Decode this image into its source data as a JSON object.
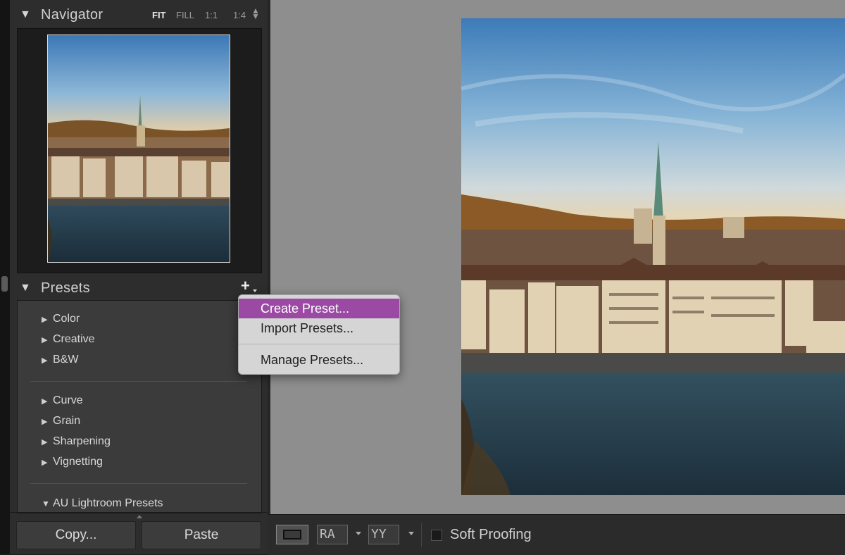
{
  "navigator": {
    "title": "Navigator",
    "zoom_options": [
      "FIT",
      "FILL",
      "1:1",
      "1:4"
    ],
    "active_zoom": "FIT"
  },
  "presets": {
    "title": "Presets",
    "groups_a": [
      "Color",
      "Creative",
      "B&W"
    ],
    "groups_b": [
      "Curve",
      "Grain",
      "Sharpening",
      "Vignetting"
    ],
    "groups_c": [
      "AU Lightroom Presets"
    ]
  },
  "buttons": {
    "copy": "Copy...",
    "paste": "Paste"
  },
  "context_menu": {
    "items": [
      "Create Preset...",
      "Import Presets...",
      "Manage Presets..."
    ],
    "highlighted": "Create Preset..."
  },
  "toolbar": {
    "before_after_label": "RA",
    "compare_label": "YY",
    "soft_proofing_label": "Soft Proofing"
  },
  "colors": {
    "menu_highlight": "#9b4aa3",
    "panel_bg": "#2d2d2d",
    "canvas_bg": "#8e8e8e"
  }
}
